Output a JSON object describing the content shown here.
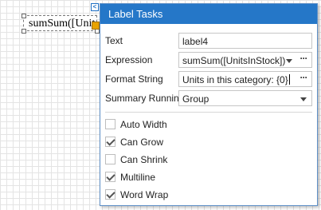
{
  "design_surface": {
    "label_text": "sumSum([UnitsInStock])"
  },
  "tasks_panel": {
    "title": "Label Tasks",
    "properties": [
      {
        "label": "Text",
        "value": "label4",
        "editor": "text"
      },
      {
        "label": "Expression",
        "value": "sumSum([UnitsInStock])",
        "editor": "dropdown-ellipsis"
      },
      {
        "label": "Format String",
        "value": "Units in this category: {0}",
        "editor": "text-ellipsis"
      },
      {
        "label": "Summary Running",
        "value": "Group",
        "editor": "dropdown"
      }
    ],
    "options": [
      {
        "label": "Auto Width",
        "checked": false
      },
      {
        "label": "Can Grow",
        "checked": true
      },
      {
        "label": "Can Shrink",
        "checked": false
      },
      {
        "label": "Multiline",
        "checked": true
      },
      {
        "label": "Word Wrap",
        "checked": true
      }
    ],
    "ellipsis_symbol": "···",
    "toggle_symbol": "<"
  },
  "colors": {
    "header": "#2577c8",
    "panel_border": "#5c8ec6",
    "smart_tag": "#e8a300"
  }
}
